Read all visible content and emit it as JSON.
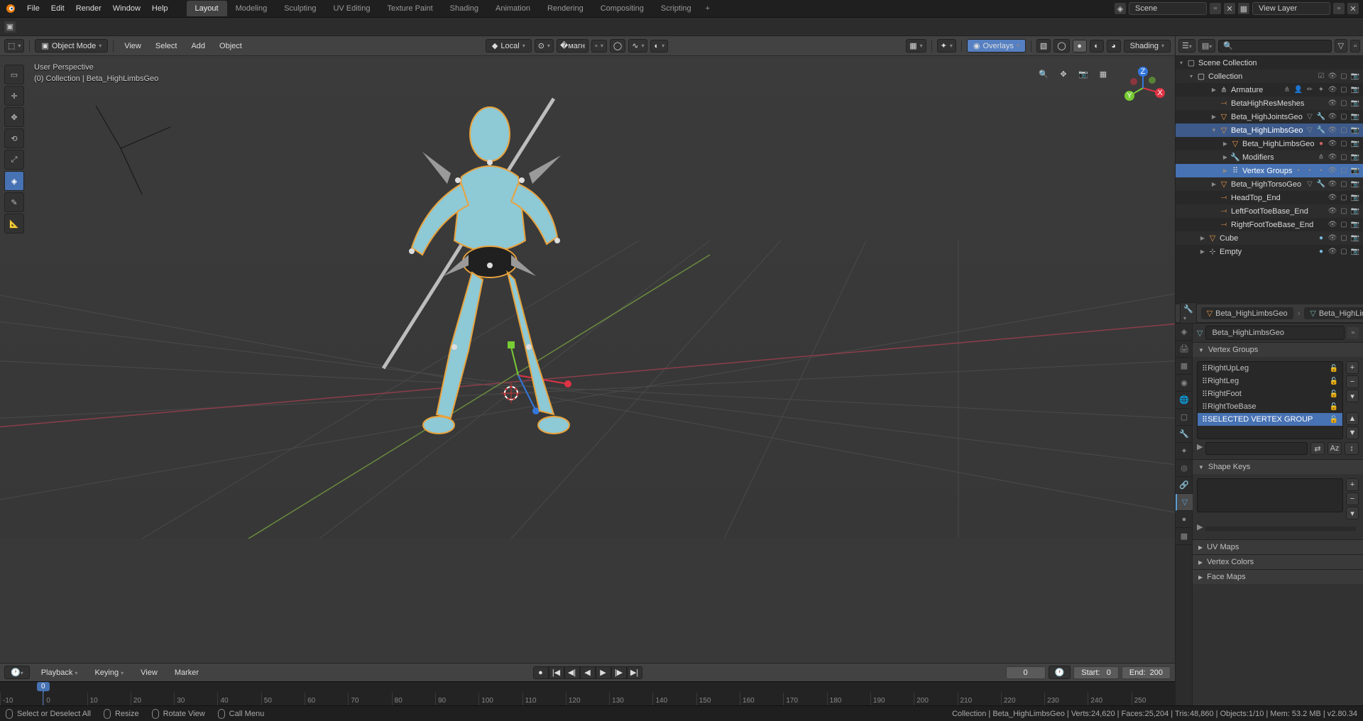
{
  "topbar": {
    "menus": [
      "File",
      "Edit",
      "Render",
      "Window",
      "Help"
    ],
    "workspaces": [
      "Layout",
      "Modeling",
      "Sculpting",
      "UV Editing",
      "Texture Paint",
      "Shading",
      "Animation",
      "Rendering",
      "Compositing",
      "Scripting"
    ],
    "active_workspace": "Layout",
    "scene_label": "Scene",
    "view_layer_label": "View Layer"
  },
  "viewport_header": {
    "mode": "Object Mode",
    "menus": [
      "View",
      "Select",
      "Add",
      "Object"
    ],
    "orientation": "Local",
    "overlays_label": "Overlays",
    "shading_label": "Shading"
  },
  "viewport_info": {
    "line1": "User Perspective",
    "line2": "(0) Collection | Beta_HighLimbsGeo"
  },
  "timeline": {
    "menus": [
      "Playback",
      "Keying",
      "View",
      "Marker"
    ],
    "current_frame": "0",
    "start_label": "Start:",
    "start_value": "0",
    "end_label": "End:",
    "end_value": "200",
    "ticks": [
      "-10",
      "0",
      "10",
      "20",
      "30",
      "40",
      "50",
      "60",
      "70",
      "80",
      "90",
      "100",
      "110",
      "120",
      "130",
      "140",
      "150",
      "160",
      "170",
      "180",
      "190",
      "200",
      "210",
      "220",
      "230",
      "240",
      "250"
    ]
  },
  "status": {
    "hint1": "Select or Deselect All",
    "hint2": "Resize",
    "hint3": "Rotate View",
    "hint4": "Call Menu",
    "right": "Collection | Beta_HighLimbsGeo | Verts:24,620 | Faces:25,204 | Tris:48,860 | Objects:1/10 | Mem: 53.2 MB | v2.80.34"
  },
  "outliner": {
    "root": "Scene Collection",
    "collection": "Collection",
    "items": [
      {
        "indent": 2,
        "icon": "armature",
        "label": "Armature",
        "expand": "▶",
        "extras": true
      },
      {
        "indent": 2,
        "icon": "bone",
        "label": "BetaHighResMeshes"
      },
      {
        "indent": 2,
        "icon": "mesh",
        "label": "Beta_HighJointsGeo",
        "expand": "▶",
        "extras_mesh": true
      },
      {
        "indent": 2,
        "icon": "mesh",
        "label": "Beta_HighLimbsGeo",
        "expand": "▼",
        "active": true,
        "extras_mesh": true
      },
      {
        "indent": 3,
        "icon": "mesh",
        "label": "Beta_HighLimbsGeo",
        "expand": "▶",
        "mat": true
      },
      {
        "indent": 3,
        "icon": "wrench",
        "label": "Modifiers",
        "expand": "▶",
        "arm": true
      },
      {
        "indent": 3,
        "icon": "vg",
        "label": "Vertex Groups",
        "expand": "▶",
        "selected": true,
        "dots": true
      },
      {
        "indent": 2,
        "icon": "mesh",
        "label": "Beta_HighTorsoGeo",
        "expand": "▶",
        "extras_mesh": true
      },
      {
        "indent": 2,
        "icon": "bone",
        "label": "HeadTop_End"
      },
      {
        "indent": 2,
        "icon": "bone",
        "label": "LeftFootToeBase_End"
      },
      {
        "indent": 2,
        "icon": "bone",
        "label": "RightFootToeBase_End"
      },
      {
        "indent": 1,
        "icon": "mesh",
        "label": "Cube",
        "expand": "▶",
        "mat2": true
      },
      {
        "indent": 1,
        "icon": "empty",
        "label": "Empty",
        "expand": "▶",
        "mat2": true
      }
    ]
  },
  "properties": {
    "breadcrumb_obj": "Beta_HighLimbsGeo",
    "breadcrumb_mesh": "Beta_HighLimbsGeo",
    "mesh_name": "Beta_HighLimbsGeo",
    "panels": {
      "vertex_groups": "Vertex Groups",
      "shape_keys": "Shape Keys",
      "uv_maps": "UV Maps",
      "vertex_colors": "Vertex Colors",
      "face_maps": "Face Maps"
    },
    "vertex_groups": [
      "RightUpLeg",
      "RightLeg",
      "RightFoot",
      "RightToeBase",
      "SELECTED VERTEX GROUP"
    ],
    "selected_vg_index": 4
  }
}
